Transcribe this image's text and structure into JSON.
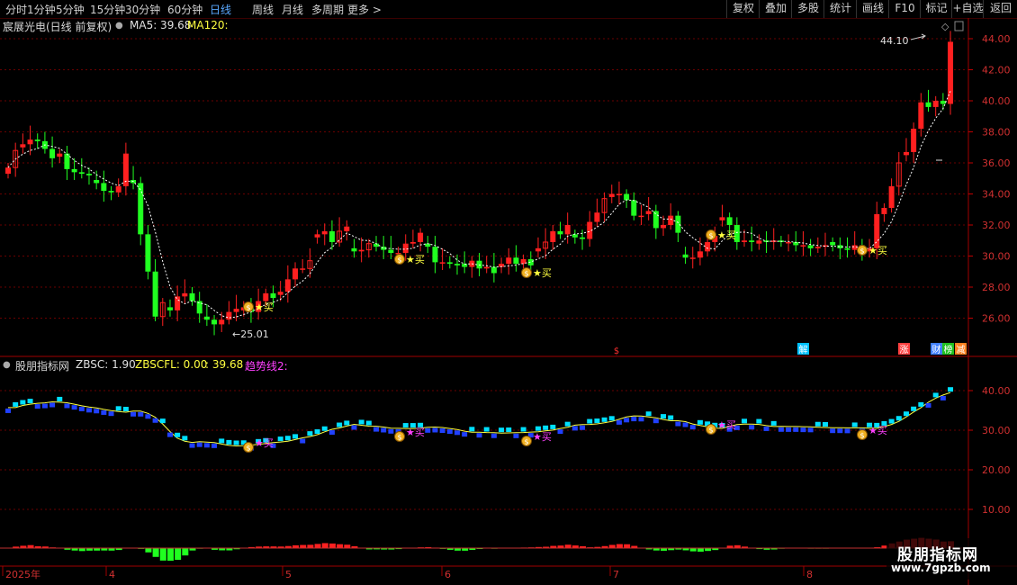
{
  "toolbar": {
    "left": [
      "分时",
      "1分钟",
      "5分钟",
      "15分钟",
      "30分钟",
      "60分钟",
      "日线",
      "周线",
      "月线",
      "多周期",
      "更多 >"
    ],
    "active": "日线",
    "right": [
      "复权",
      "叠加",
      "多股",
      "统计",
      "画线",
      "F10",
      "标记",
      "+自选",
      "返回"
    ]
  },
  "main_header": {
    "stock": "宸展光电(日线 前复权)",
    "ma5": "MA5: 39.68",
    "ma120": "MA120:"
  },
  "sub_header": {
    "name": "股朋指标网",
    "zbsc": "ZBSC: 1.90",
    "zbscfl": "ZBSCFL: 0.00",
    "val": ": 39.68",
    "trend": "趋势线2:"
  },
  "colors": {
    "up": "#ff2020",
    "down": "#20ff20",
    "cyan": "#00e0ff",
    "blue": "#2040ff",
    "yellow": "#ffff40",
    "grid": "#6a0000",
    "magenta": "#ff40ff"
  },
  "chart_data": [
    {
      "type": "candlestick",
      "title": "宸展光电(日线 前复权)",
      "y_ticks": [
        "44.00",
        "42.00",
        "40.00",
        "38.00",
        "36.00",
        "34.00",
        "32.00",
        "30.00",
        "28.00",
        "26.00"
      ],
      "ylim": [
        24.5,
        45.2
      ],
      "x_ticks": [
        "2025年",
        "4",
        "5",
        "6",
        "7",
        "8"
      ],
      "annotations": {
        "high": "44.10",
        "low": "25.01",
        "buy": "★买",
        "markers": [
          "$",
          "解",
          "涨",
          "财",
          "榜",
          "减"
        ]
      },
      "closes": [
        35.7,
        36.8,
        37.2,
        37.5,
        37.4,
        36.9,
        36.3,
        36.6,
        35.6,
        35.4,
        35.3,
        35.2,
        34.7,
        34.2,
        34.1,
        34.5,
        36.6,
        34.7,
        31.4,
        29.0,
        26.1,
        27.0,
        26.5,
        27.4,
        27.6,
        27.1,
        26.3,
        25.9,
        25.6,
        25.9,
        26.4,
        26.6,
        26.7,
        26.4,
        27.1,
        27.6,
        27.3,
        27.7,
        28.5,
        29.2,
        29.2,
        29.7,
        31.4,
        31.6,
        30.9,
        31.6,
        31.9,
        30.3,
        30.4,
        30.8,
        30.6,
        30.4,
        30.2,
        30.2,
        30.8,
        30.9,
        31.5,
        30.6,
        29.6,
        29.6,
        29.5,
        29.4,
        29.3,
        29.7,
        29.2,
        29.3,
        28.9,
        29.5,
        29.9,
        29.5,
        29.8,
        29.4,
        30.5,
        30.9,
        31.6,
        31.4,
        32.0,
        31.2,
        31.1,
        32.2,
        32.8,
        33.7,
        34.0,
        34.0,
        33.6,
        32.6,
        32.6,
        32.9,
        31.8,
        32.0,
        32.6,
        31.5,
        29.9,
        29.9,
        30.3,
        30.9,
        31.3,
        32.5,
        32.0,
        30.9,
        31.0,
        30.9,
        31.0,
        30.9,
        31.0,
        30.9,
        30.9,
        30.7,
        30.7,
        30.5,
        30.6,
        30.7,
        30.7,
        30.5,
        30.4,
        30.7,
        30.3,
        30.5,
        32.7,
        33.1,
        34.5,
        36.0,
        36.7,
        38.2,
        39.9,
        39.6,
        40.0,
        39.8,
        43.8
      ]
    },
    {
      "type": "line",
      "title": "股朋指标网",
      "y_ticks": [
        "40.00",
        "30.00",
        "20.00",
        "10.00"
      ],
      "ylim": [
        0,
        46
      ],
      "series": [
        {
          "name": "ZBSC"
        },
        {
          "name": "ZBSCFL"
        },
        {
          "name": "趋势线2"
        }
      ]
    }
  ],
  "watermark": {
    "title": "股朋指标网",
    "url": "www.7gpzb.com"
  }
}
